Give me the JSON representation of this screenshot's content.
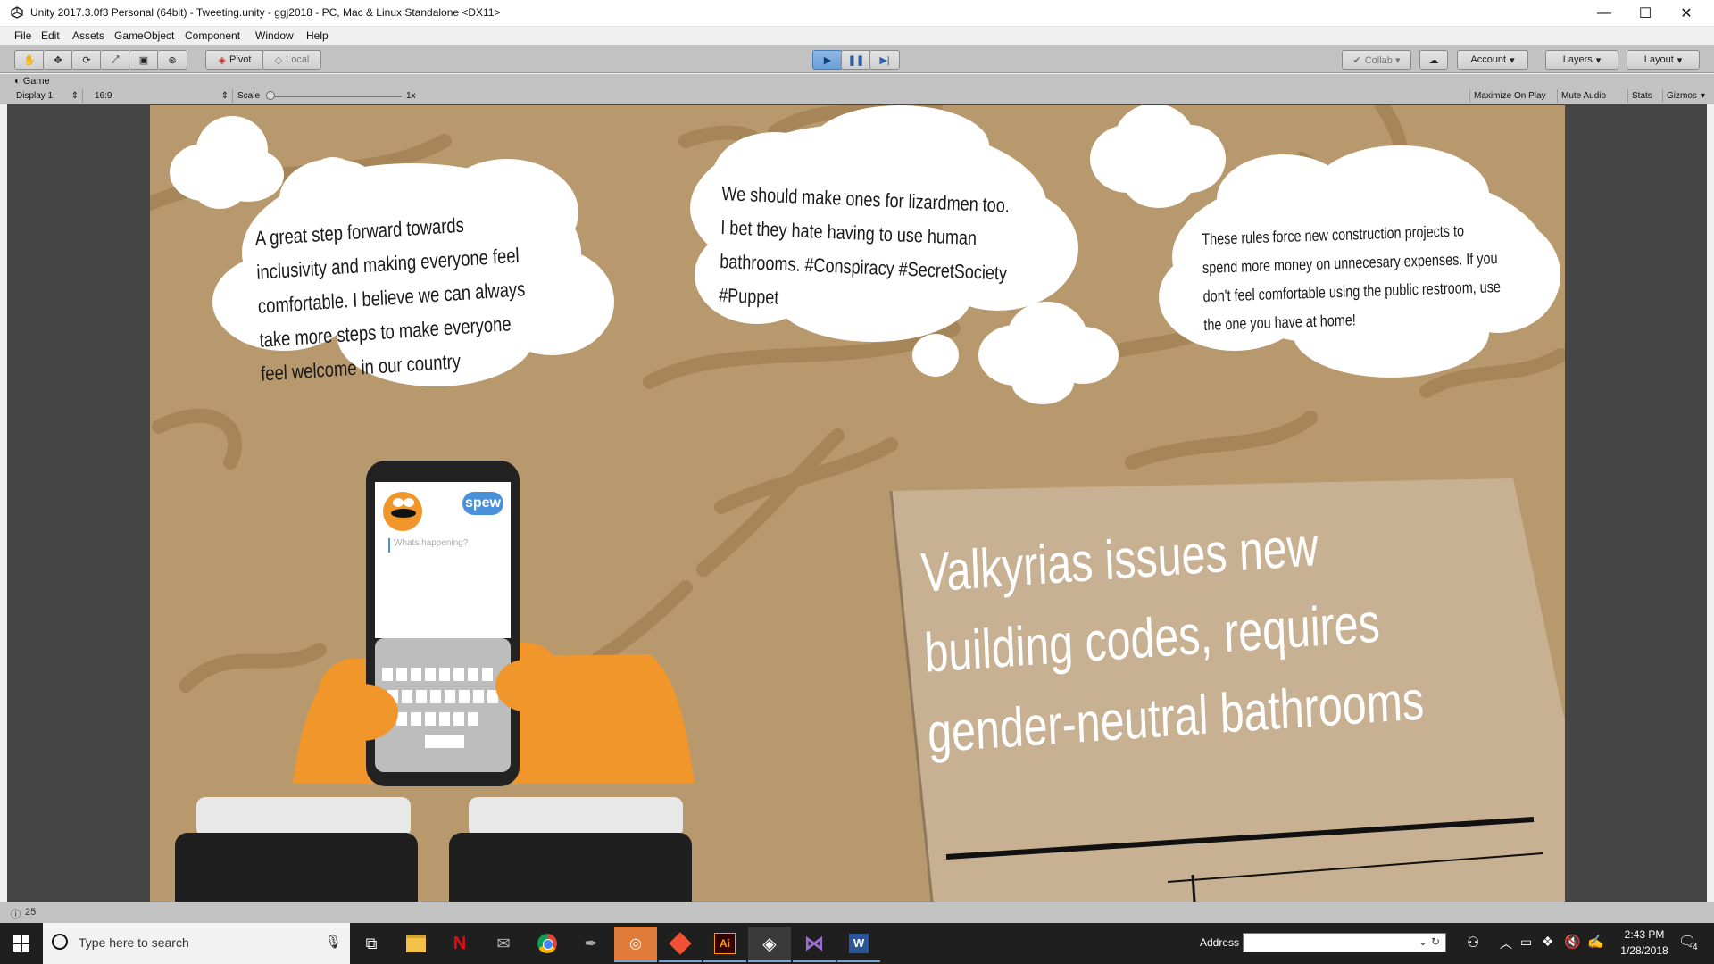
{
  "window": {
    "title": "Unity 2017.3.0f3 Personal (64bit) - Tweeting.unity - ggj2018 - PC, Mac & Linux Standalone <DX11>",
    "minimize": "—",
    "maximize": "☐",
    "close": "✕"
  },
  "menu": [
    "File",
    "Edit",
    "Assets",
    "GameObject",
    "Component",
    "Window",
    "Help"
  ],
  "toolbar": {
    "pivot": "Pivot",
    "local": "Local",
    "collab": "Collab ▾",
    "account": "Account",
    "layers": "Layers",
    "layout": "Layout"
  },
  "game_panel": {
    "tab": "Game",
    "display": "Display 1",
    "aspect": "16:9",
    "scale_label": "Scale",
    "scale_value": "1x",
    "maximize_on_play": "Maximize On Play",
    "mute_audio": "Mute Audio",
    "stats": "Stats",
    "gizmos": "Gizmos"
  },
  "game": {
    "tweets": [
      "A great step forward towards inclusivity and making everyone feel comfortable. I believe we can always take more steps to make everyone feel welcome in our country",
      "We should make ones for lizardmen too. I bet they hate having to use human bathrooms. #Conspiracy #SecretSociety #Puppet",
      "These rules force new construction projects to spend more money on unnecesary expenses. If you don't feel comfortable using the public restroom, use the one you have at home!"
    ],
    "phone": {
      "spew_button": "spew",
      "compose_placeholder": "Whats happening?"
    },
    "headline": "Valkyrias issues new building codes, requires gender-neutral bathrooms"
  },
  "status": {
    "console_count": "25"
  },
  "taskbar": {
    "search_placeholder": "Type here to search",
    "address_label": "Address",
    "time": "2:43 PM",
    "date": "1/28/2018",
    "notifications": "4"
  },
  "colors": {
    "game_bg": "#b8996e",
    "character_orange": "#f0962a",
    "spew_blue": "#4a90d9",
    "sign_tan": "#c8b092"
  }
}
